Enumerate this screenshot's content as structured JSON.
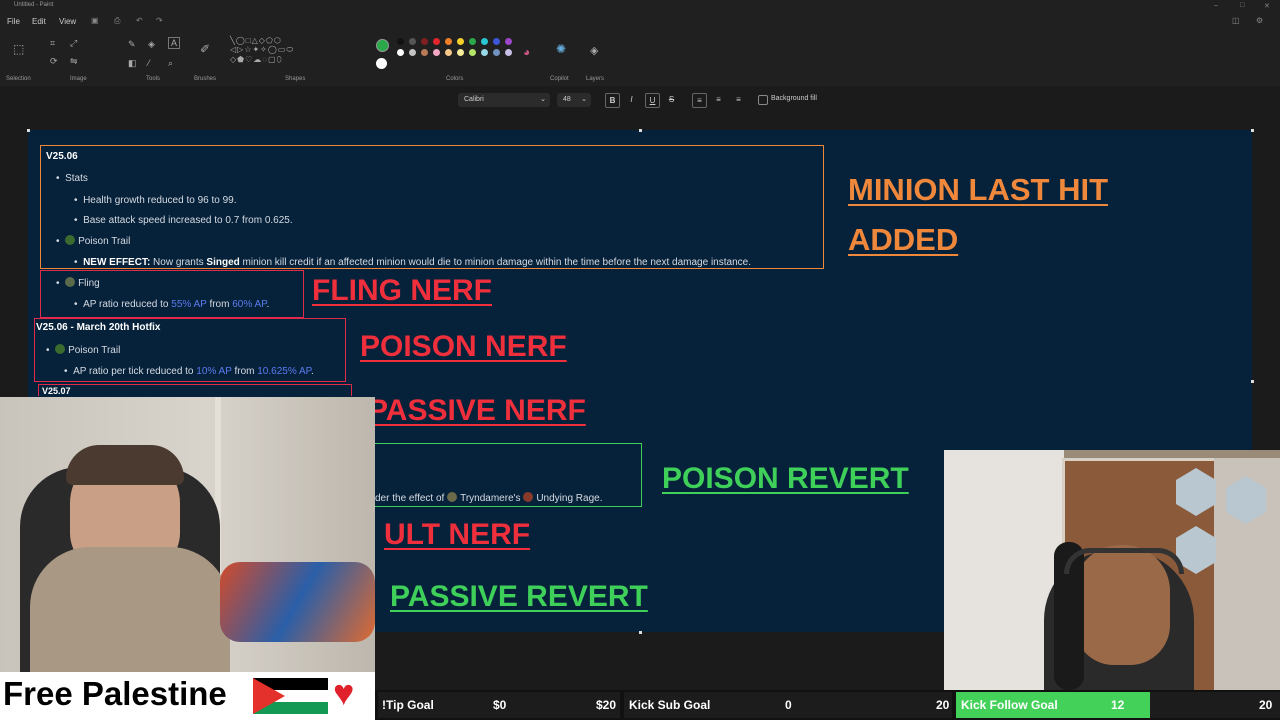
{
  "window": {
    "title": "Untitled - Paint"
  },
  "menu": {
    "file": "File",
    "edit": "Edit",
    "view": "View"
  },
  "ribbon": {
    "groups": [
      "Selection",
      "Image",
      "Tools",
      "Brushes",
      "Shapes",
      "Colors",
      "Copilot",
      "Layers"
    ],
    "colors": [
      "#111111",
      "#555555",
      "#7f1f1f",
      "#e3262d",
      "#f07f2a",
      "#f5d02a",
      "#2aa84a",
      "#2ac7d3",
      "#3b56d6",
      "#9e45c9",
      "#ffffff",
      "#c3c3c3",
      "#b97a57",
      "#f5a7c3",
      "#f8c78a",
      "#f7ec9a",
      "#b4e46a",
      "#99d9ea",
      "#7092be",
      "#c8bfe7"
    ],
    "primary_color": "#2aa84a",
    "secondary_color": "#ffffff"
  },
  "format": {
    "font": "Calibri",
    "size": "48",
    "background_fill": "Background fill"
  },
  "patch": {
    "v2506": "V25.06",
    "stats": "Stats",
    "health": "Health growth reduced to 96 to 99.",
    "attack_speed": "Base attack speed increased to 0.7 from 0.625.",
    "poison_trail": "Poison Trail",
    "new_effect_label": "NEW EFFECT:",
    "new_effect_pre": " Now grants ",
    "new_effect_champ": "Singed",
    "new_effect_post": " minion kill credit if an affected minion would die to minion damage within the time before the next damage instance.",
    "fling": "Fling",
    "fling_pre": "AP ratio reduced to ",
    "fling_new": "55% AP",
    "fling_mid": " from ",
    "fling_old": "60% AP",
    "fling_end": ".",
    "hotfix": "V25.06 - March 20th Hotfix",
    "poison_trail_2": "Poison Trail",
    "tick_pre": "AP ratio per tick reduced to ",
    "tick_new": "10% AP",
    "tick_mid": " from ",
    "tick_old": "10.625% AP",
    "tick_end": ".",
    "v2507": "V25.07",
    "undying_pre": "der the effect of ",
    "undying_champ": "Tryndamere's",
    "undying_mid": " ",
    "undying_ability": "Undying Rage",
    "undying_end": "."
  },
  "notes": {
    "minion_1": "MINION LAST HIT",
    "minion_2": "ADDED",
    "fling_nerf": "FLING NERF",
    "poison_nerf": "POISON NERF",
    "passive_nerf": "PASSIVE NERF",
    "poison_revert": "POISON REVERT",
    "ult_nerf": "ULT NERF",
    "passive_revert": "PASSIVE REVERT"
  },
  "overlay": {
    "free": "Free Palestine",
    "tip_label": "!Tip Goal",
    "tip_current": "$0",
    "tip_target": "$20",
    "sub_label": "Kick Sub Goal",
    "sub_current": "0",
    "sub_target": "20",
    "follow_label": "Kick Follow Goal",
    "follow_current": "12",
    "follow_target": "20",
    "follow_progress": 0.6
  }
}
